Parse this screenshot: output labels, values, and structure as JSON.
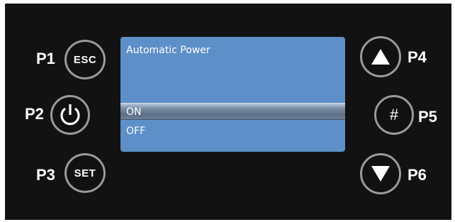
{
  "screen": {
    "title": "Automatic Power",
    "options": [
      {
        "label": "ON",
        "selected": true
      },
      {
        "label": "OFF",
        "selected": false
      }
    ]
  },
  "buttons": {
    "p1": {
      "label": "P1",
      "text": "ESC"
    },
    "p2": {
      "label": "P2",
      "icon": "power-icon"
    },
    "p3": {
      "label": "P3",
      "text": "SET"
    },
    "p4": {
      "label": "P4",
      "icon": "up-triangle-icon"
    },
    "p5": {
      "label": "P5",
      "text": "#"
    },
    "p6": {
      "label": "P6",
      "icon": "down-triangle-icon"
    }
  },
  "colors": {
    "panel": "#121212",
    "screen": "#5d8fc9",
    "button_border": "#9a9a9a",
    "text": "#ffffff"
  }
}
